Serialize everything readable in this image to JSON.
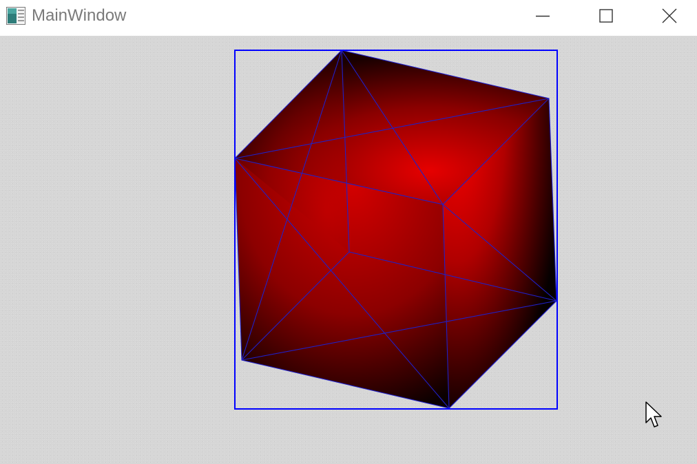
{
  "window": {
    "title": "MainWindow",
    "app_icon": "app-window-icon",
    "controls": {
      "minimize_icon": "minimize-icon",
      "maximize_icon": "maximize-icon",
      "close_icon": "close-icon"
    }
  },
  "viewport": {
    "background_color": "#d6d6d6",
    "bounding_box_color": "#0000ff",
    "wireframe_color": "#1a1acc",
    "shape": "cube",
    "shading": "radial-red",
    "face_colors": {
      "highlight": "#ff0000",
      "mid": "#a00000",
      "shadow": "#000000"
    }
  },
  "cursor": {
    "icon": "mouse-pointer-icon"
  }
}
